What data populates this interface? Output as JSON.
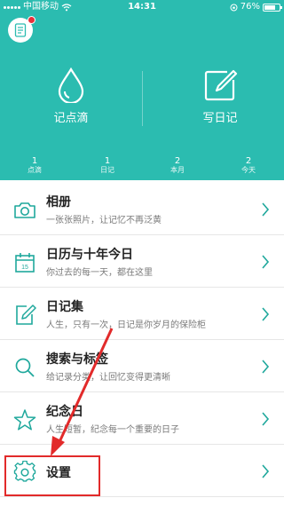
{
  "status_bar": {
    "carrier": "中国移动",
    "time": "14:31",
    "battery": "76%",
    "battery_level": 0.76
  },
  "header": {
    "actions": [
      {
        "label": "记点滴",
        "icon": "droplet-icon"
      },
      {
        "label": "写日记",
        "icon": "edit-icon"
      }
    ],
    "stats": [
      {
        "value": "1",
        "label": "点滴"
      },
      {
        "value": "1",
        "label": "日记"
      },
      {
        "value": "2",
        "label": "本月"
      },
      {
        "value": "2",
        "label": "今天"
      }
    ]
  },
  "menu": {
    "items": [
      {
        "title": "相册",
        "subtitle": "一张张照片，让记忆不再泛黄",
        "icon": "camera-icon"
      },
      {
        "title": "日历与十年今日",
        "subtitle": "你过去的每一天，都在这里",
        "icon": "calendar-icon",
        "calendar_day": "15"
      },
      {
        "title": "日记集",
        "subtitle": "人生，只有一次，日记是你岁月的保险柜",
        "icon": "notebook-edit-icon"
      },
      {
        "title": "搜索与标签",
        "subtitle": "给记录分类，让回忆变得更清晰",
        "icon": "search-icon"
      },
      {
        "title": "纪念日",
        "subtitle": "人生短暂，纪念每一个重要的日子",
        "icon": "star-icon"
      },
      {
        "title": "设置",
        "subtitle": "",
        "icon": "gear-icon"
      }
    ]
  },
  "colors": {
    "header_bg": "#2bbcb0",
    "icon_teal": "#1fa89c",
    "highlight_red": "#e22a2a"
  }
}
